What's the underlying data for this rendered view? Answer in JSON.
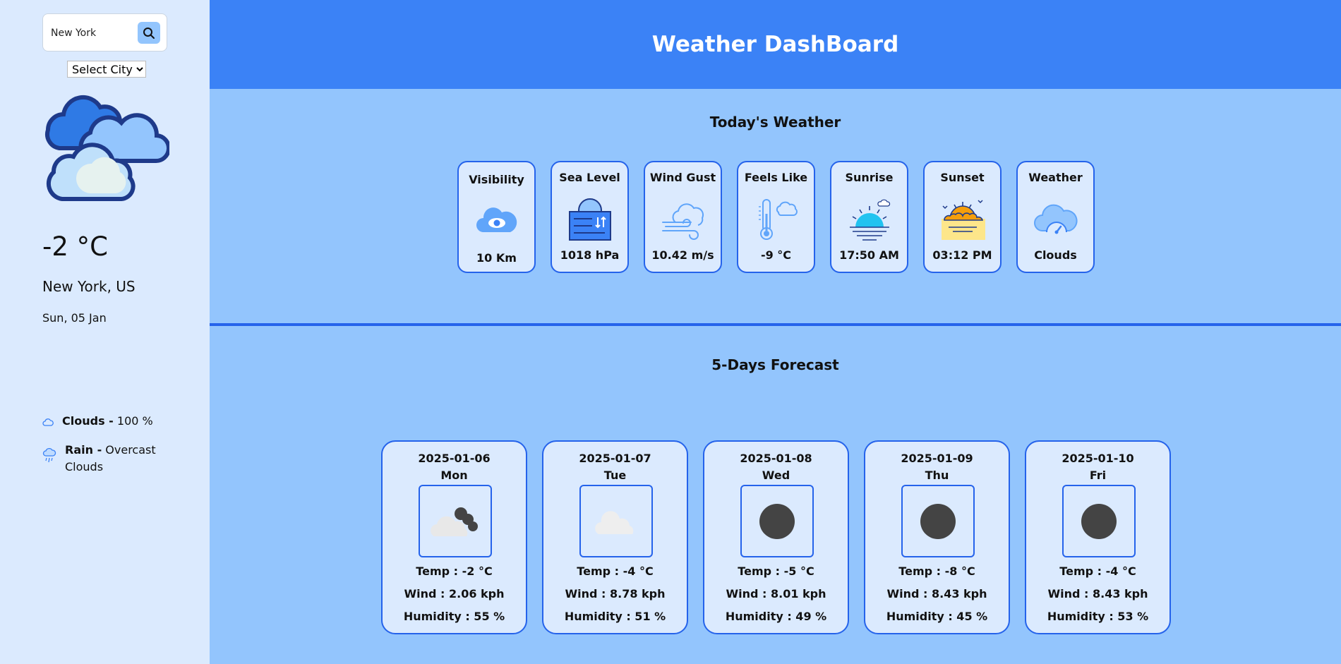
{
  "sidebar": {
    "search_value": "New York",
    "select_label": "Select City",
    "temperature": "-2 °C",
    "location": "New York, US",
    "date": "Sun, 05 Jan",
    "clouds_label": "Clouds -",
    "clouds_value": "100 %",
    "rain_label": "Rain -",
    "rain_value": "Overcast Clouds"
  },
  "header": {
    "title": "Weather DashBoard"
  },
  "today": {
    "title": "Today's Weather",
    "cards": [
      {
        "label": "Visibility",
        "value": "10 Km",
        "icon": "eye-cloud-icon"
      },
      {
        "label": "Sea Level",
        "value": "1018 hPa",
        "icon": "sea-level-icon"
      },
      {
        "label": "Wind Gust",
        "value": "10.42 m/s",
        "icon": "wind-icon"
      },
      {
        "label": "Feels Like",
        "value": "-9 °C",
        "icon": "thermometer-icon"
      },
      {
        "label": "Sunrise",
        "value": "17:50 AM",
        "icon": "sunrise-icon"
      },
      {
        "label": "Sunset",
        "value": "03:12 PM",
        "icon": "sunset-icon"
      },
      {
        "label": "Weather",
        "value": "Clouds",
        "icon": "cloud-gauge-icon"
      }
    ]
  },
  "forecast": {
    "title": "5-Days Forecast",
    "days": [
      {
        "date": "2025-01-06",
        "day": "Mon",
        "temp": "Temp : -2 °C",
        "wind": "Wind : 2.06 kph",
        "humidity": "Humidity : 55 %",
        "icon": "broken-clouds-icon"
      },
      {
        "date": "2025-01-07",
        "day": "Tue",
        "temp": "Temp : -4 °C",
        "wind": "Wind : 8.78 kph",
        "humidity": "Humidity : 51 %",
        "icon": "few-clouds-icon"
      },
      {
        "date": "2025-01-08",
        "day": "Wed",
        "temp": "Temp : -5 °C",
        "wind": "Wind : 8.01 kph",
        "humidity": "Humidity : 49 %",
        "icon": "dark-circle-icon"
      },
      {
        "date": "2025-01-09",
        "day": "Thu",
        "temp": "Temp : -8 °C",
        "wind": "Wind : 8.43 kph",
        "humidity": "Humidity : 45 %",
        "icon": "dark-circle-icon"
      },
      {
        "date": "2025-01-10",
        "day": "Fri",
        "temp": "Temp : -4 °C",
        "wind": "Wind : 8.43 kph",
        "humidity": "Humidity : 53 %",
        "icon": "dark-circle-icon"
      }
    ]
  },
  "colors": {
    "header": "#3b82f6",
    "background": "#93c5fd",
    "sidebar": "#dbeafe",
    "card_border": "#2563eb"
  }
}
